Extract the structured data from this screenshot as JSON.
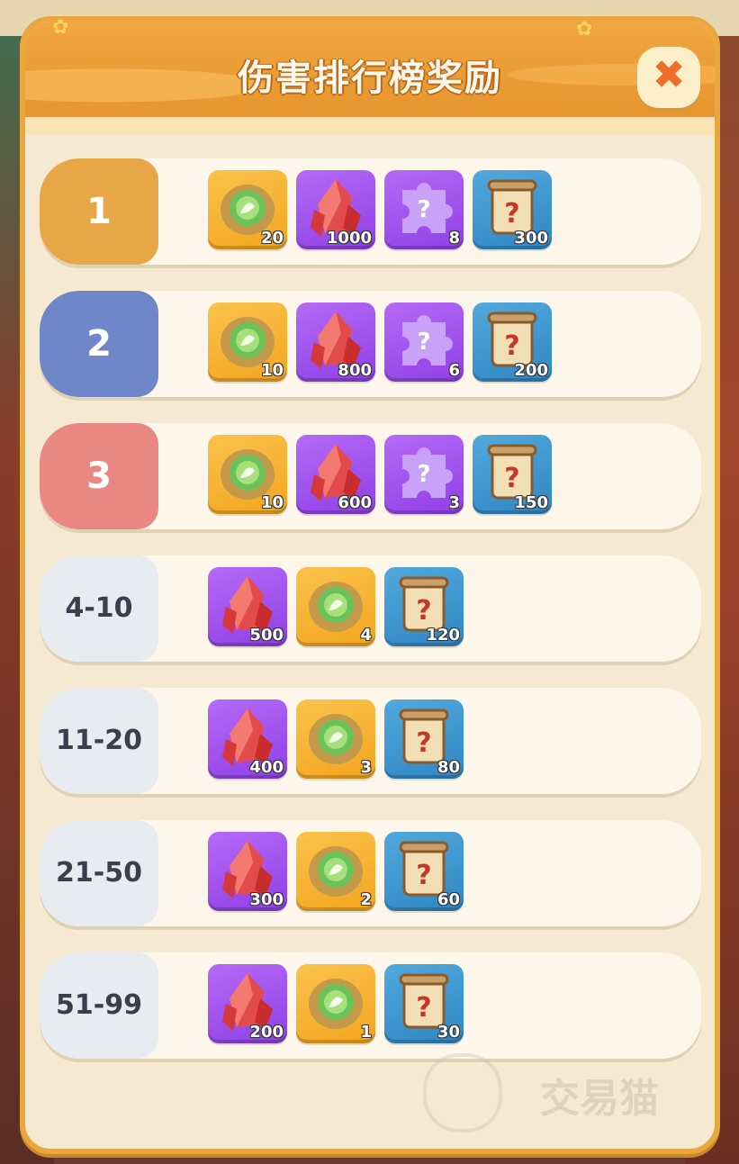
{
  "title": "伤害排行榜奖励",
  "close_icon_glyph": "✖",
  "colors": {
    "rank1": "#e8a746",
    "rank2": "#6f86c9",
    "rank3": "#e98882",
    "rank_other": "#e8ebf0"
  },
  "rows": [
    {
      "rank": "1",
      "style": "rank1",
      "items": [
        {
          "icon": "cabbage-icon",
          "qty": "20"
        },
        {
          "icon": "red-crystal-icon",
          "qty": "1000"
        },
        {
          "icon": "puzzle-piece-icon",
          "qty": "8"
        },
        {
          "icon": "mystery-scroll-icon",
          "qty": "300"
        }
      ]
    },
    {
      "rank": "2",
      "style": "rank2",
      "items": [
        {
          "icon": "cabbage-icon",
          "qty": "10"
        },
        {
          "icon": "red-crystal-icon",
          "qty": "800"
        },
        {
          "icon": "puzzle-piece-icon",
          "qty": "6"
        },
        {
          "icon": "mystery-scroll-icon",
          "qty": "200"
        }
      ]
    },
    {
      "rank": "3",
      "style": "rank3",
      "items": [
        {
          "icon": "cabbage-icon",
          "qty": "10"
        },
        {
          "icon": "red-crystal-icon",
          "qty": "600"
        },
        {
          "icon": "puzzle-piece-icon",
          "qty": "3"
        },
        {
          "icon": "mystery-scroll-icon",
          "qty": "150"
        }
      ]
    },
    {
      "rank": "4-10",
      "style": "rank_other",
      "items": [
        {
          "icon": "red-crystal-icon",
          "qty": "500"
        },
        {
          "icon": "cabbage-icon",
          "qty": "4"
        },
        {
          "icon": "mystery-scroll-icon",
          "qty": "120"
        }
      ]
    },
    {
      "rank": "11-20",
      "style": "rank_other",
      "items": [
        {
          "icon": "red-crystal-icon",
          "qty": "400"
        },
        {
          "icon": "cabbage-icon",
          "qty": "3"
        },
        {
          "icon": "mystery-scroll-icon",
          "qty": "80"
        }
      ]
    },
    {
      "rank": "21-50",
      "style": "rank_other",
      "items": [
        {
          "icon": "red-crystal-icon",
          "qty": "300"
        },
        {
          "icon": "cabbage-icon",
          "qty": "2"
        },
        {
          "icon": "mystery-scroll-icon",
          "qty": "60"
        }
      ]
    },
    {
      "rank": "51-99",
      "style": "rank_other",
      "items": [
        {
          "icon": "red-crystal-icon",
          "qty": "200"
        },
        {
          "icon": "cabbage-icon",
          "qty": "1"
        },
        {
          "icon": "mystery-scroll-icon",
          "qty": "30"
        }
      ]
    }
  ],
  "watermark": "交易猫"
}
